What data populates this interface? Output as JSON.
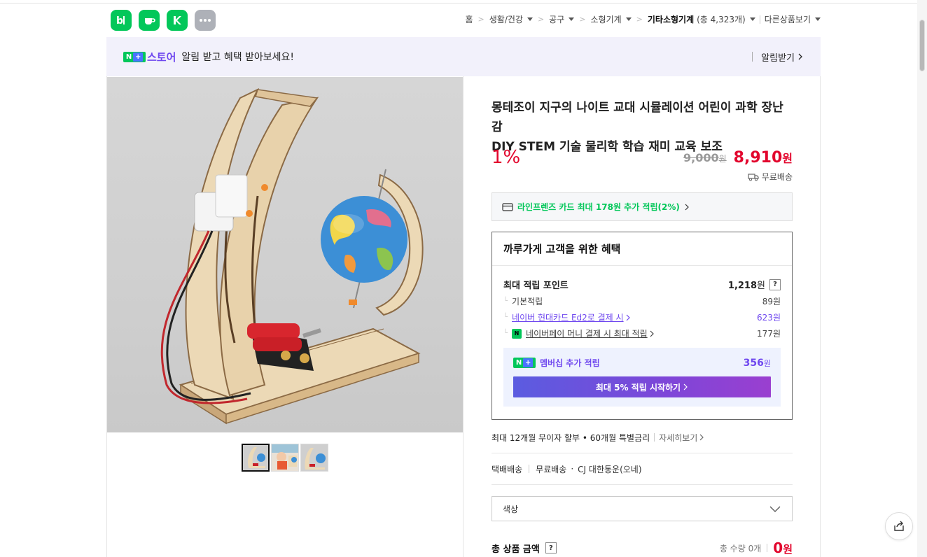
{
  "apps": [
    {
      "name": "blog-app",
      "glyph": "b|"
    },
    {
      "name": "cafe-app",
      "glyph": "cup"
    },
    {
      "name": "kakao-app",
      "glyph": "K"
    },
    {
      "name": "more-apps",
      "glyph": "..."
    }
  ],
  "breadcrumb": {
    "home": "홈",
    "c1": "생활/건강",
    "c2": "공구",
    "c3": "소형기계",
    "c4_bold": "기타소형기계",
    "c4_count": "(총 4,323개)",
    "more": "다른상품보기"
  },
  "banner": {
    "np": "N",
    "store": "스토어",
    "text": "알림 받고 혜택 받아보세요!",
    "alarm": "알림받기"
  },
  "product": {
    "title_line1": "몽테조이 지구의 나이트 교대 시뮬레이션 어린이 과학 장난감",
    "title_line2": "DIY STEM 기술 물리학 학습 재미 교육 보조",
    "discount": "1%",
    "original_price": "9,000",
    "original_unit": "원",
    "sale_price": "8,910",
    "sale_unit": "원",
    "shipping": "무료배송"
  },
  "card_promo": "라인프렌즈 카드 최대 178원 추가 적립(2%)",
  "benefit": {
    "heading": "까루가게 고객을 위한 혜택",
    "max_points_label": "최대 적립 포인트",
    "max_points_value": "1,218",
    "max_points_unit": "원",
    "help": "?",
    "basic_label": "기본적립",
    "basic_value": "89원",
    "hyundai_label": "네이버 현대카드 Ed2로 결제 시",
    "hyundai_value": "623원",
    "npay_label": "네이버페이 머니 결제 시 최대 적립",
    "npay_value": "177원",
    "membership_label": "멤버십 추가 적립",
    "membership_value": "356",
    "membership_unit": "원",
    "membership_button": "최대 5% 적립 시작하기"
  },
  "installment": {
    "text": "최대 12개월 무이자 할부 • 60개월 특별금리",
    "link": "자세히보기"
  },
  "delivery": {
    "method": "택배배송",
    "fee": "무료배송",
    "carrier": "CJ 대한통운(오네)"
  },
  "option": {
    "placeholder": "색상"
  },
  "total": {
    "label": "총 상품 금액",
    "help": "?",
    "quantity": "총 수량 0개",
    "amount": "0",
    "unit": "원"
  },
  "colors": {
    "naver_green": "#03c75a",
    "sale_red": "#e2062d",
    "purple": "#6f48ef"
  }
}
